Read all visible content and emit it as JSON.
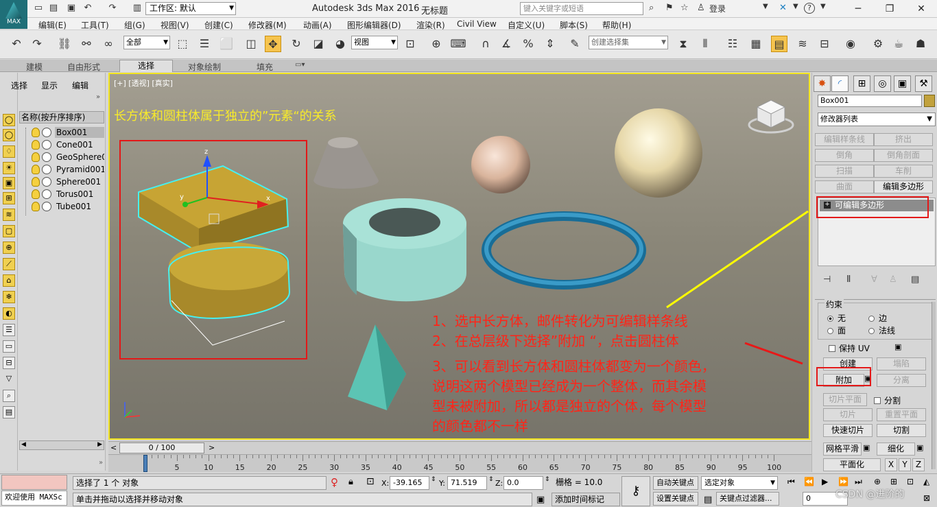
{
  "app": {
    "title": "Autodesk 3ds Max 2016",
    "doc_title": "无标题",
    "logo_text": "MAX",
    "workspace_label": "工作区: 默认",
    "search_placeholder": "键入关键字或短语",
    "login_label": "登录",
    "help_label": "?"
  },
  "menu": [
    "编辑(E)",
    "工具(T)",
    "组(G)",
    "视图(V)",
    "创建(C)",
    "修改器(M)",
    "动画(A)",
    "图形编辑器(D)",
    "渲染(R)",
    "Civil View",
    "自定义(U)",
    "脚本(S)",
    "帮助(H)"
  ],
  "toolbar": {
    "selection_filter": "全部",
    "ref_coord": "视图",
    "named_selection_placeholder": "创建选择集"
  },
  "ribbon": {
    "tabs": [
      "建模",
      "自由形式",
      "选择",
      "对象绘制",
      "填充"
    ],
    "active": "选择"
  },
  "explorer": {
    "tabs": [
      "选择",
      "显示",
      "编辑"
    ],
    "column_header": "名称(按升序排序)",
    "objects": [
      "Box001",
      "Cone001",
      "GeoSphere0",
      "Pyramid001",
      "Sphere001",
      "Torus001",
      "Tube001"
    ],
    "selected": "Box001"
  },
  "viewport": {
    "label": "[+] [透视] [真实]",
    "headline": "长方体和圆柱体属于独立的”元素“的关系",
    "annotation_lines": [
      "1、选中长方体，邮件转化为可编辑样条线",
      "2、在总层级下选择”附加 “，点击圆柱体",
      "3、可以看到长方体和圆柱体都变为一个颜色，",
      "说明这两个模型已经成为一个整体，而其余模",
      "型未被附加，所以都是独立的个体，每个模型",
      "的颜色都不一样"
    ],
    "gizmo_axes": [
      "z",
      "y",
      "x"
    ],
    "annotation_color": "#ff2418",
    "headline_color": "#f8eb2a",
    "highlight_color": "#e31818"
  },
  "timeline": {
    "frame_display": "0 / 100",
    "ticks": [
      "0",
      "5",
      "10",
      "15",
      "20",
      "25",
      "30",
      "35",
      "40",
      "45",
      "50",
      "55",
      "60",
      "65",
      "70",
      "75",
      "80",
      "85",
      "90",
      "95",
      "100"
    ]
  },
  "command_panel": {
    "object_name": "Box001",
    "object_color": "#c2a23d",
    "modifier_list_label": "修改器列表",
    "modifier_buttons": [
      "编辑样条线",
      "挤出",
      "倒角",
      "倒角剖面",
      "扫描",
      "车削",
      "曲面",
      "编辑多边形"
    ],
    "stack_item": "可编辑多边形",
    "constraints": {
      "title": "约束",
      "options": [
        "无",
        "边",
        "面",
        "法线"
      ],
      "selected": "无"
    },
    "preserve_uv": "保持 UV",
    "geometry_buttons": [
      "创建",
      "塌陷",
      "附加",
      "分离",
      "切片平面",
      "分割",
      "切片",
      "重置平面",
      "快速切片",
      "切割",
      "网格平滑",
      "细化",
      "平面化",
      "X",
      "Y",
      "Z"
    ]
  },
  "status": {
    "maxscript_label": "欢迎使用 MAXSc",
    "selection_text": "选择了 1 个 对象",
    "prompt_text": "单击并拖动以选择并移动对象",
    "x_label": "X:",
    "x_value": "-39.165",
    "y_label": "Y:",
    "y_value": "71.519",
    "z_label": "Z:",
    "z_value": "0.0",
    "grid_label": "栅格 = 10.0",
    "auto_key": "自动关键点",
    "set_key": "设置关键点",
    "selected_object_dropdown": "选定对象",
    "key_filters": "关键点过滤器...",
    "add_time_tag": "添加时间标记",
    "frame_field": "0",
    "watermark": "CSDN @进阶的"
  }
}
